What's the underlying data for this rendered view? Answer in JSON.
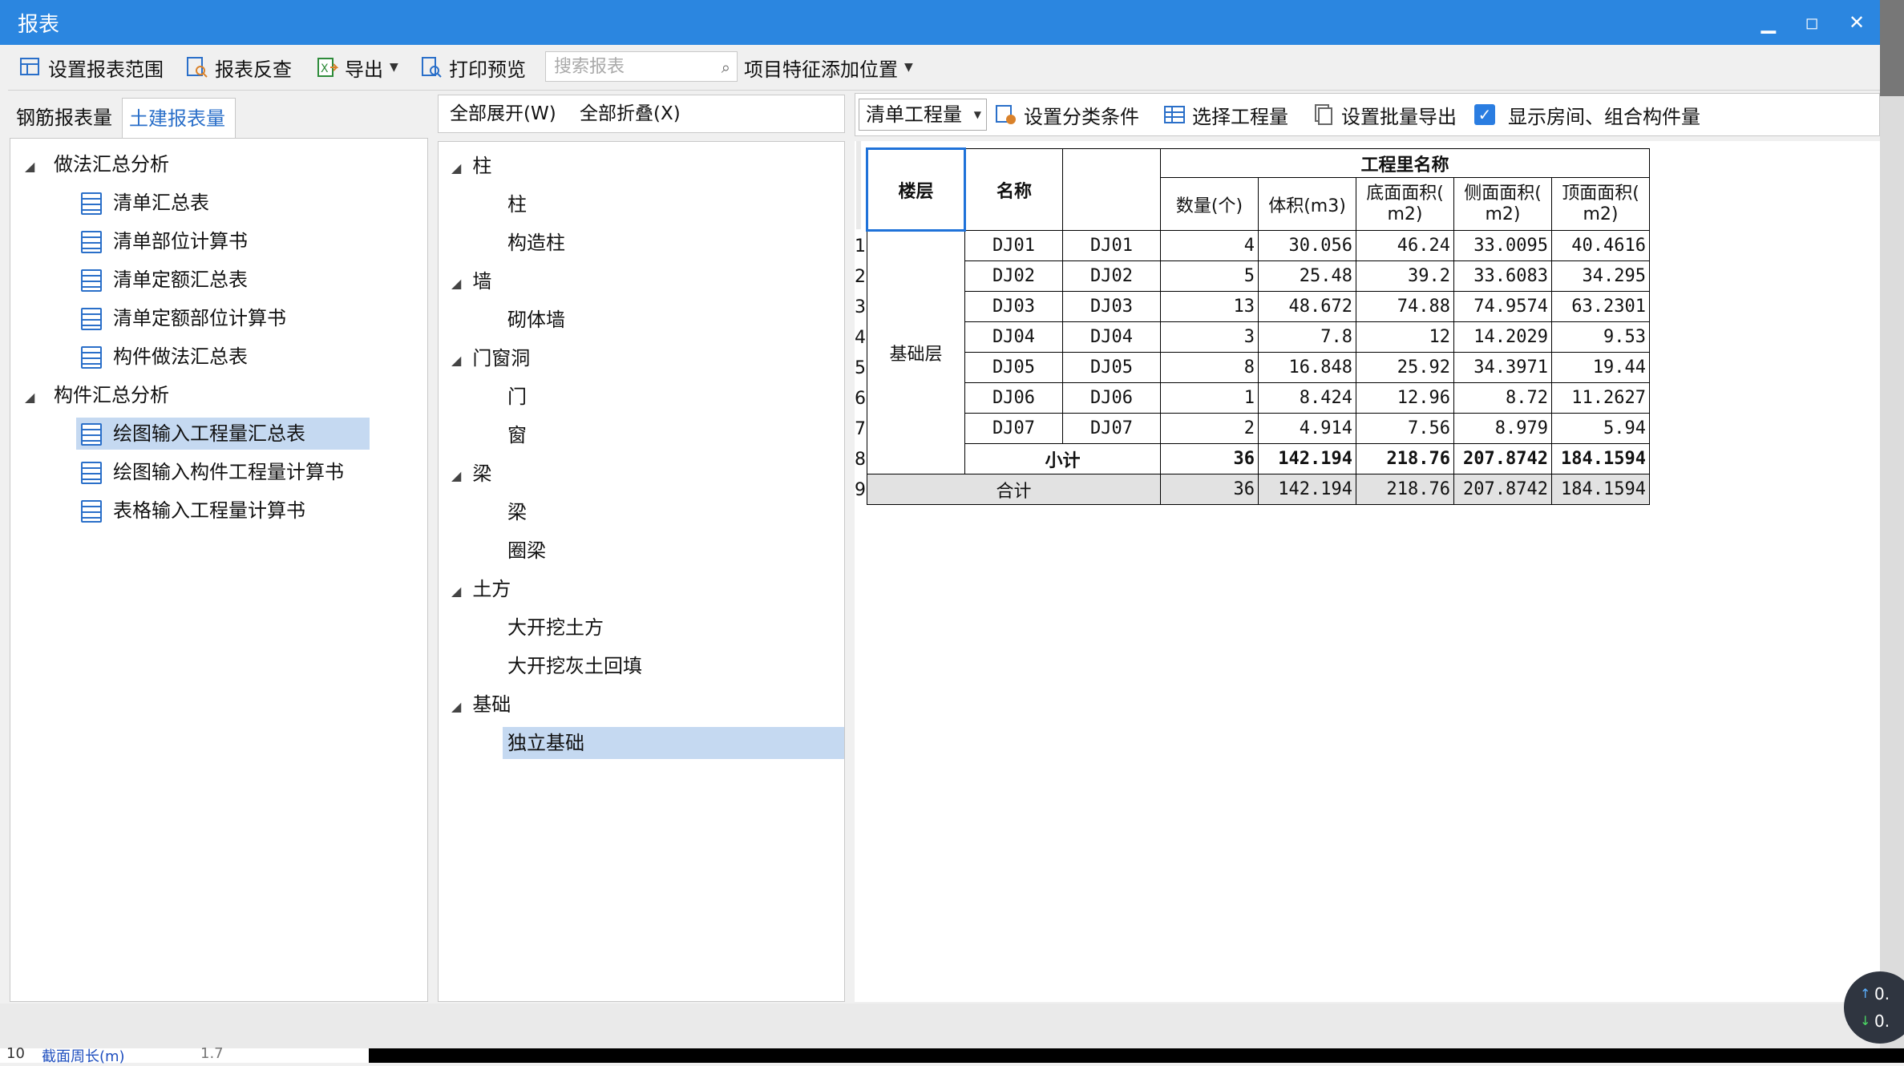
{
  "window": {
    "title": "报表"
  },
  "toolbar": {
    "set_range": "设置报表范围",
    "reverse_check": "报表反查",
    "export": "导出",
    "print_preview": "打印预览",
    "search_placeholder": "搜索报表",
    "add_position": "项目特征添加位置"
  },
  "left_tabs": {
    "rebar": "钢筋报表量",
    "civil": "土建报表量"
  },
  "left_tree": {
    "group1": "做法汇总分析",
    "group1_items": [
      "清单汇总表",
      "清单部位计算书",
      "清单定额汇总表",
      "清单定额部位计算书",
      "构件做法汇总表"
    ],
    "group2": "构件汇总分析",
    "group2_items": [
      "绘图输入工程量汇总表",
      "绘图输入构件工程量计算书",
      "表格输入工程量计算书"
    ]
  },
  "middle": {
    "expand_all": "全部展开(W)",
    "collapse_all": "全部折叠(X)",
    "tree": [
      {
        "label": "柱",
        "children": [
          "柱",
          "构造柱"
        ]
      },
      {
        "label": "墙",
        "children": [
          "砌体墙"
        ]
      },
      {
        "label": "门窗洞",
        "children": [
          "门",
          "窗"
        ]
      },
      {
        "label": "梁",
        "children": [
          "梁",
          "圈梁"
        ]
      },
      {
        "label": "土方",
        "children": [
          "大开挖土方",
          "大开挖灰土回填"
        ]
      },
      {
        "label": "基础",
        "children": [
          "独立基础"
        ]
      }
    ]
  },
  "right_toolbar": {
    "select_value": "清单工程量",
    "set_category": "设置分类条件",
    "select_quantity": "选择工程量",
    "batch_export": "设置批量导出",
    "show_rooms": "显示房间、组合构件量",
    "show_rooms_checked": true
  },
  "report": {
    "header_floor": "楼层",
    "header_name": "名称",
    "header_group": "工程里名称",
    "col_count": "数量(个)",
    "col_volume": "体积(m3)",
    "col_bottom_1": "底面面积(",
    "col_bottom_2": "m2)",
    "col_side_1": "侧面面积(",
    "col_side_2": "m2)",
    "col_top_1": "顶面面积(",
    "col_top_2": "m2)",
    "floor": "基础层",
    "rows": [
      {
        "n": "1",
        "name": "DJ01",
        "name2": "DJ01",
        "count": "4",
        "volume": "30.056",
        "bottom": "46.24",
        "side": "33.0095",
        "top": "40.4616"
      },
      {
        "n": "2",
        "name": "DJ02",
        "name2": "DJ02",
        "count": "5",
        "volume": "25.48",
        "bottom": "39.2",
        "side": "33.6083",
        "top": "34.295"
      },
      {
        "n": "3",
        "name": "DJ03",
        "name2": "DJ03",
        "count": "13",
        "volume": "48.672",
        "bottom": "74.88",
        "side": "74.9574",
        "top": "63.2301"
      },
      {
        "n": "4",
        "name": "DJ04",
        "name2": "DJ04",
        "count": "3",
        "volume": "7.8",
        "bottom": "12",
        "side": "14.2029",
        "top": "9.53"
      },
      {
        "n": "5",
        "name": "DJ05",
        "name2": "DJ05",
        "count": "8",
        "volume": "16.848",
        "bottom": "25.92",
        "side": "34.3971",
        "top": "19.44"
      },
      {
        "n": "6",
        "name": "DJ06",
        "name2": "DJ06",
        "count": "1",
        "volume": "8.424",
        "bottom": "12.96",
        "side": "8.72",
        "top": "11.2627"
      },
      {
        "n": "7",
        "name": "DJ07",
        "name2": "DJ07",
        "count": "2",
        "volume": "4.914",
        "bottom": "7.56",
        "side": "8.979",
        "top": "5.94"
      }
    ],
    "subtotal": {
      "n": "8",
      "label": "小计",
      "count": "36",
      "volume": "142.194",
      "bottom": "218.76",
      "side": "207.8742",
      "top": "184.1594"
    },
    "total": {
      "n": "9",
      "label": "合计",
      "count": "36",
      "volume": "142.194",
      "bottom": "218.76",
      "side": "207.8742",
      "top": "184.1594"
    }
  },
  "overlay": {
    "line1": "0.",
    "line2": "0."
  },
  "bottom_strip": {
    "row_num": "10",
    "text": "截面周长(m)",
    "val": "1.7"
  },
  "colors": {
    "titlebar": "#2b86e0",
    "selection": "#c5d9f1",
    "accent_icon": "#2a6fc9"
  }
}
